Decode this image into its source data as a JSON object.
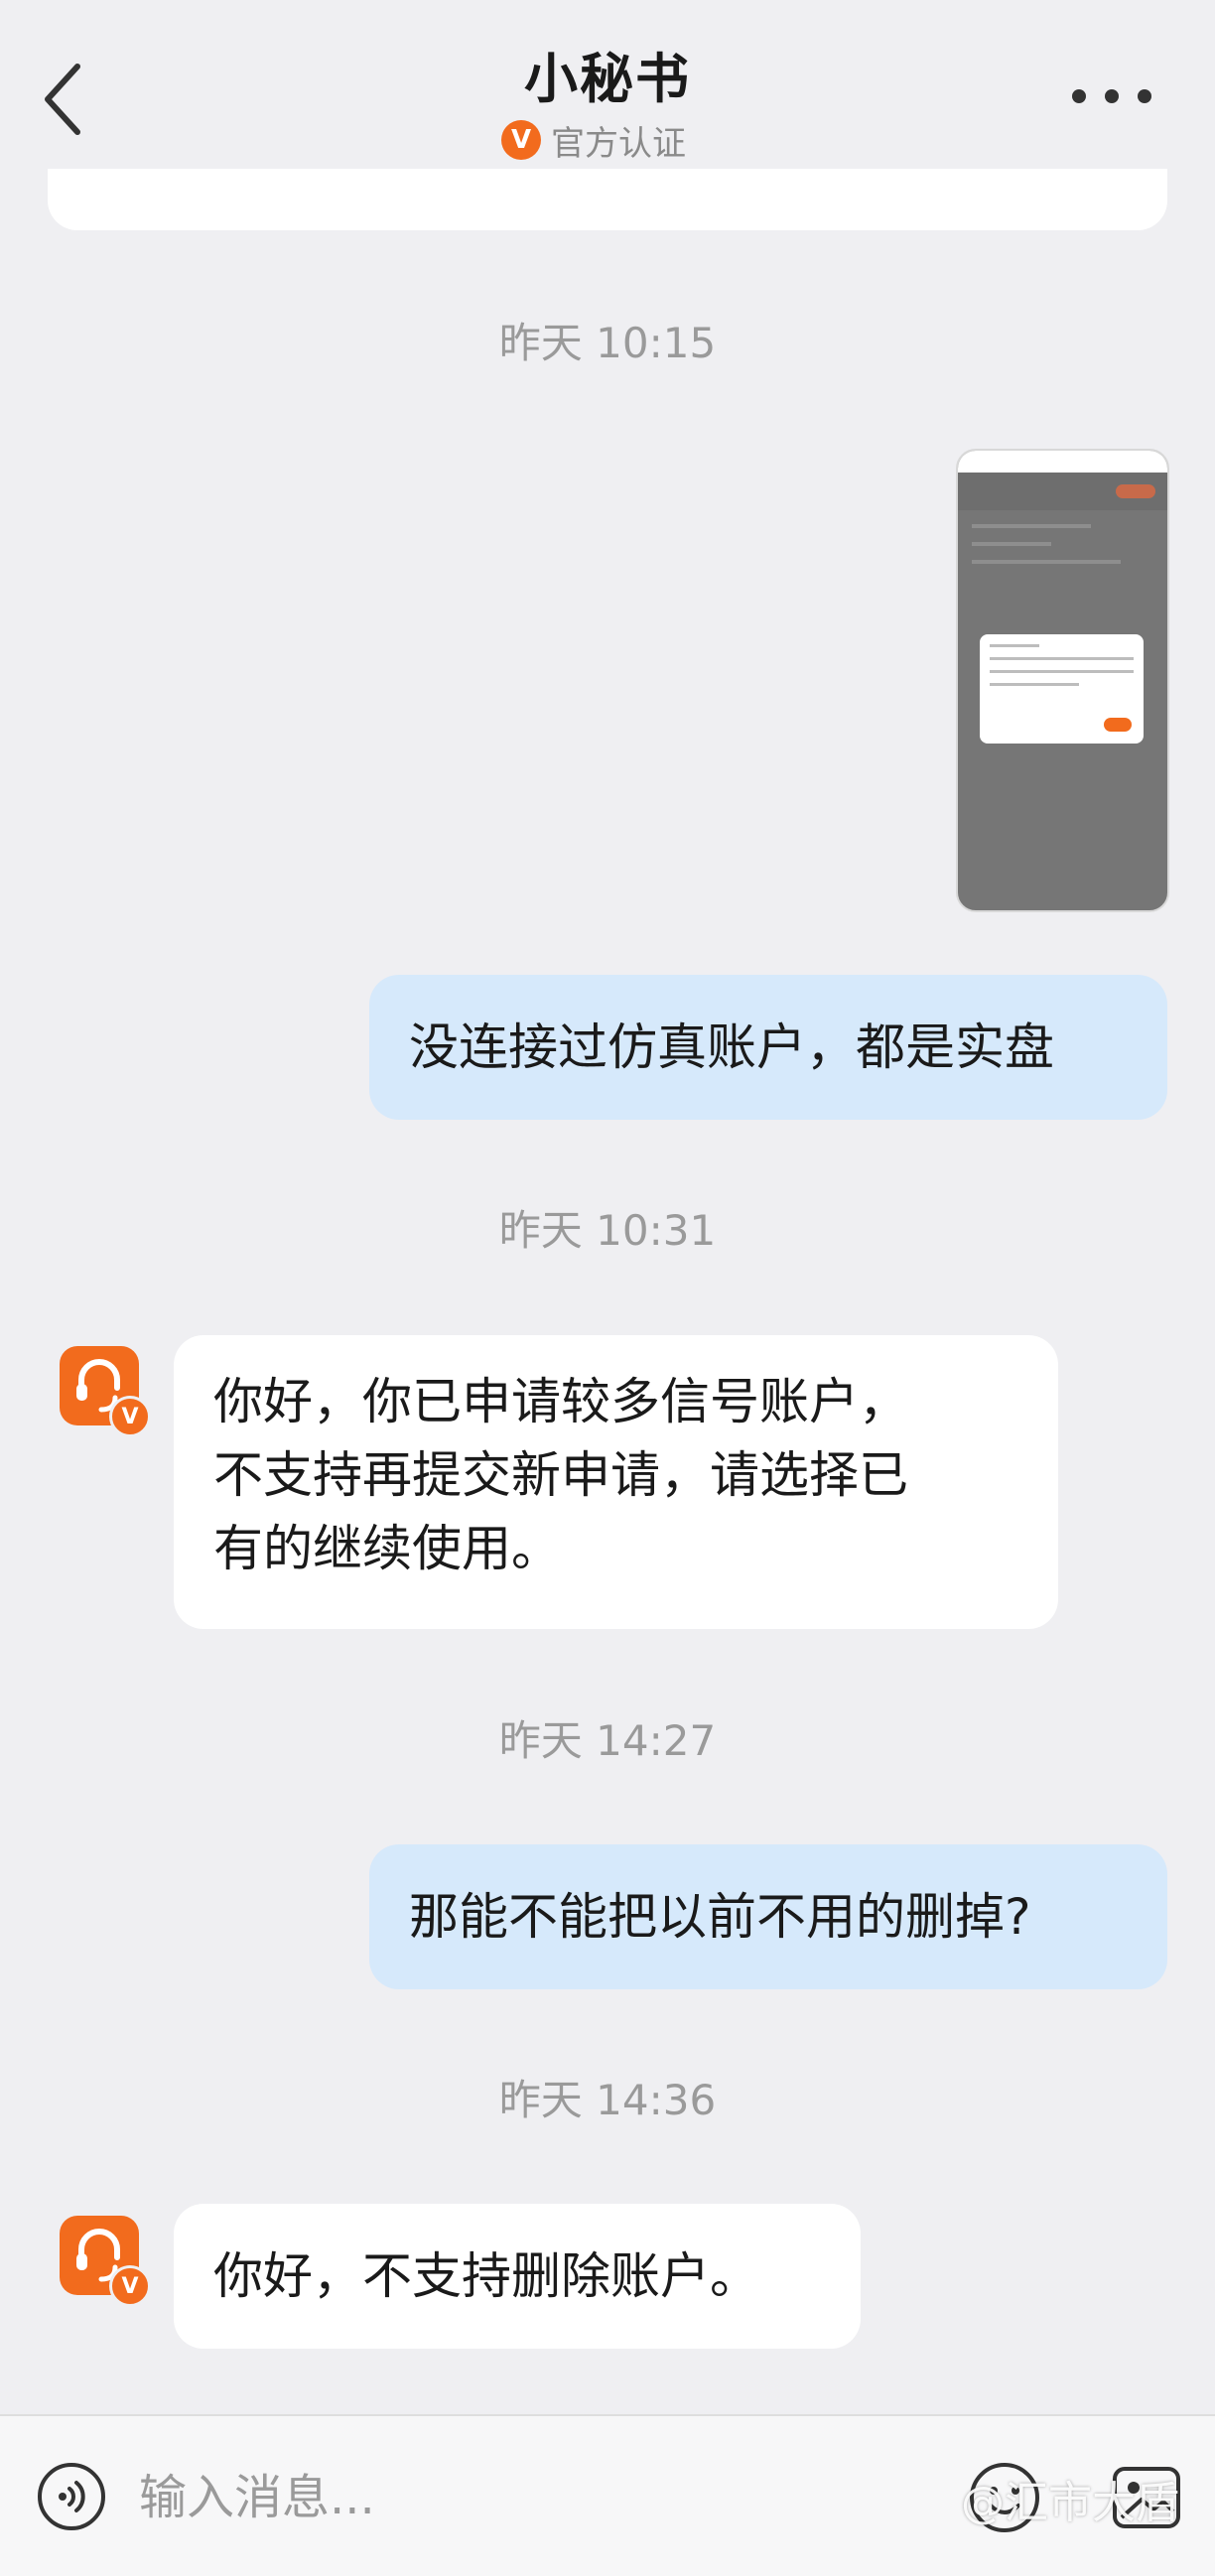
{
  "header": {
    "title": "小秘书",
    "verified_badge": "V",
    "verified_text": "官方认证"
  },
  "messages": [
    {
      "kind": "timestamp",
      "text": "昨天 10:15"
    },
    {
      "kind": "image",
      "from": "me"
    },
    {
      "kind": "text",
      "from": "me",
      "lines": [
        "没连接过仿真账户，都是实盘"
      ]
    },
    {
      "kind": "timestamp",
      "text": "昨天 10:31"
    },
    {
      "kind": "text",
      "from": "assistant",
      "lines": [
        "你好，你已申请较多信号账户，",
        "不支持再提交新申请，请选择已",
        "有的继续使用。"
      ]
    },
    {
      "kind": "timestamp",
      "text": "昨天 14:27"
    },
    {
      "kind": "text",
      "from": "me",
      "lines": [
        "那能不能把以前不用的删掉?"
      ]
    },
    {
      "kind": "timestamp",
      "text": "昨天 14:36"
    },
    {
      "kind": "text",
      "from": "assistant",
      "lines": [
        "你好，不支持删除账户。"
      ]
    }
  ],
  "avatar_badge": "V",
  "input": {
    "placeholder": "输入消息..."
  },
  "watermark": "@汇市大盾",
  "colors": {
    "background": "#efeff2",
    "outgoing_bubble": "#d6e9fb",
    "incoming_bubble": "#ffffff",
    "brand_orange": "#f26b1d"
  },
  "icons": [
    "back-arrow-icon",
    "verified-icon",
    "more-icon",
    "assistant-avatar-icon",
    "voice-icon",
    "emoji-icon",
    "image-icon"
  ]
}
